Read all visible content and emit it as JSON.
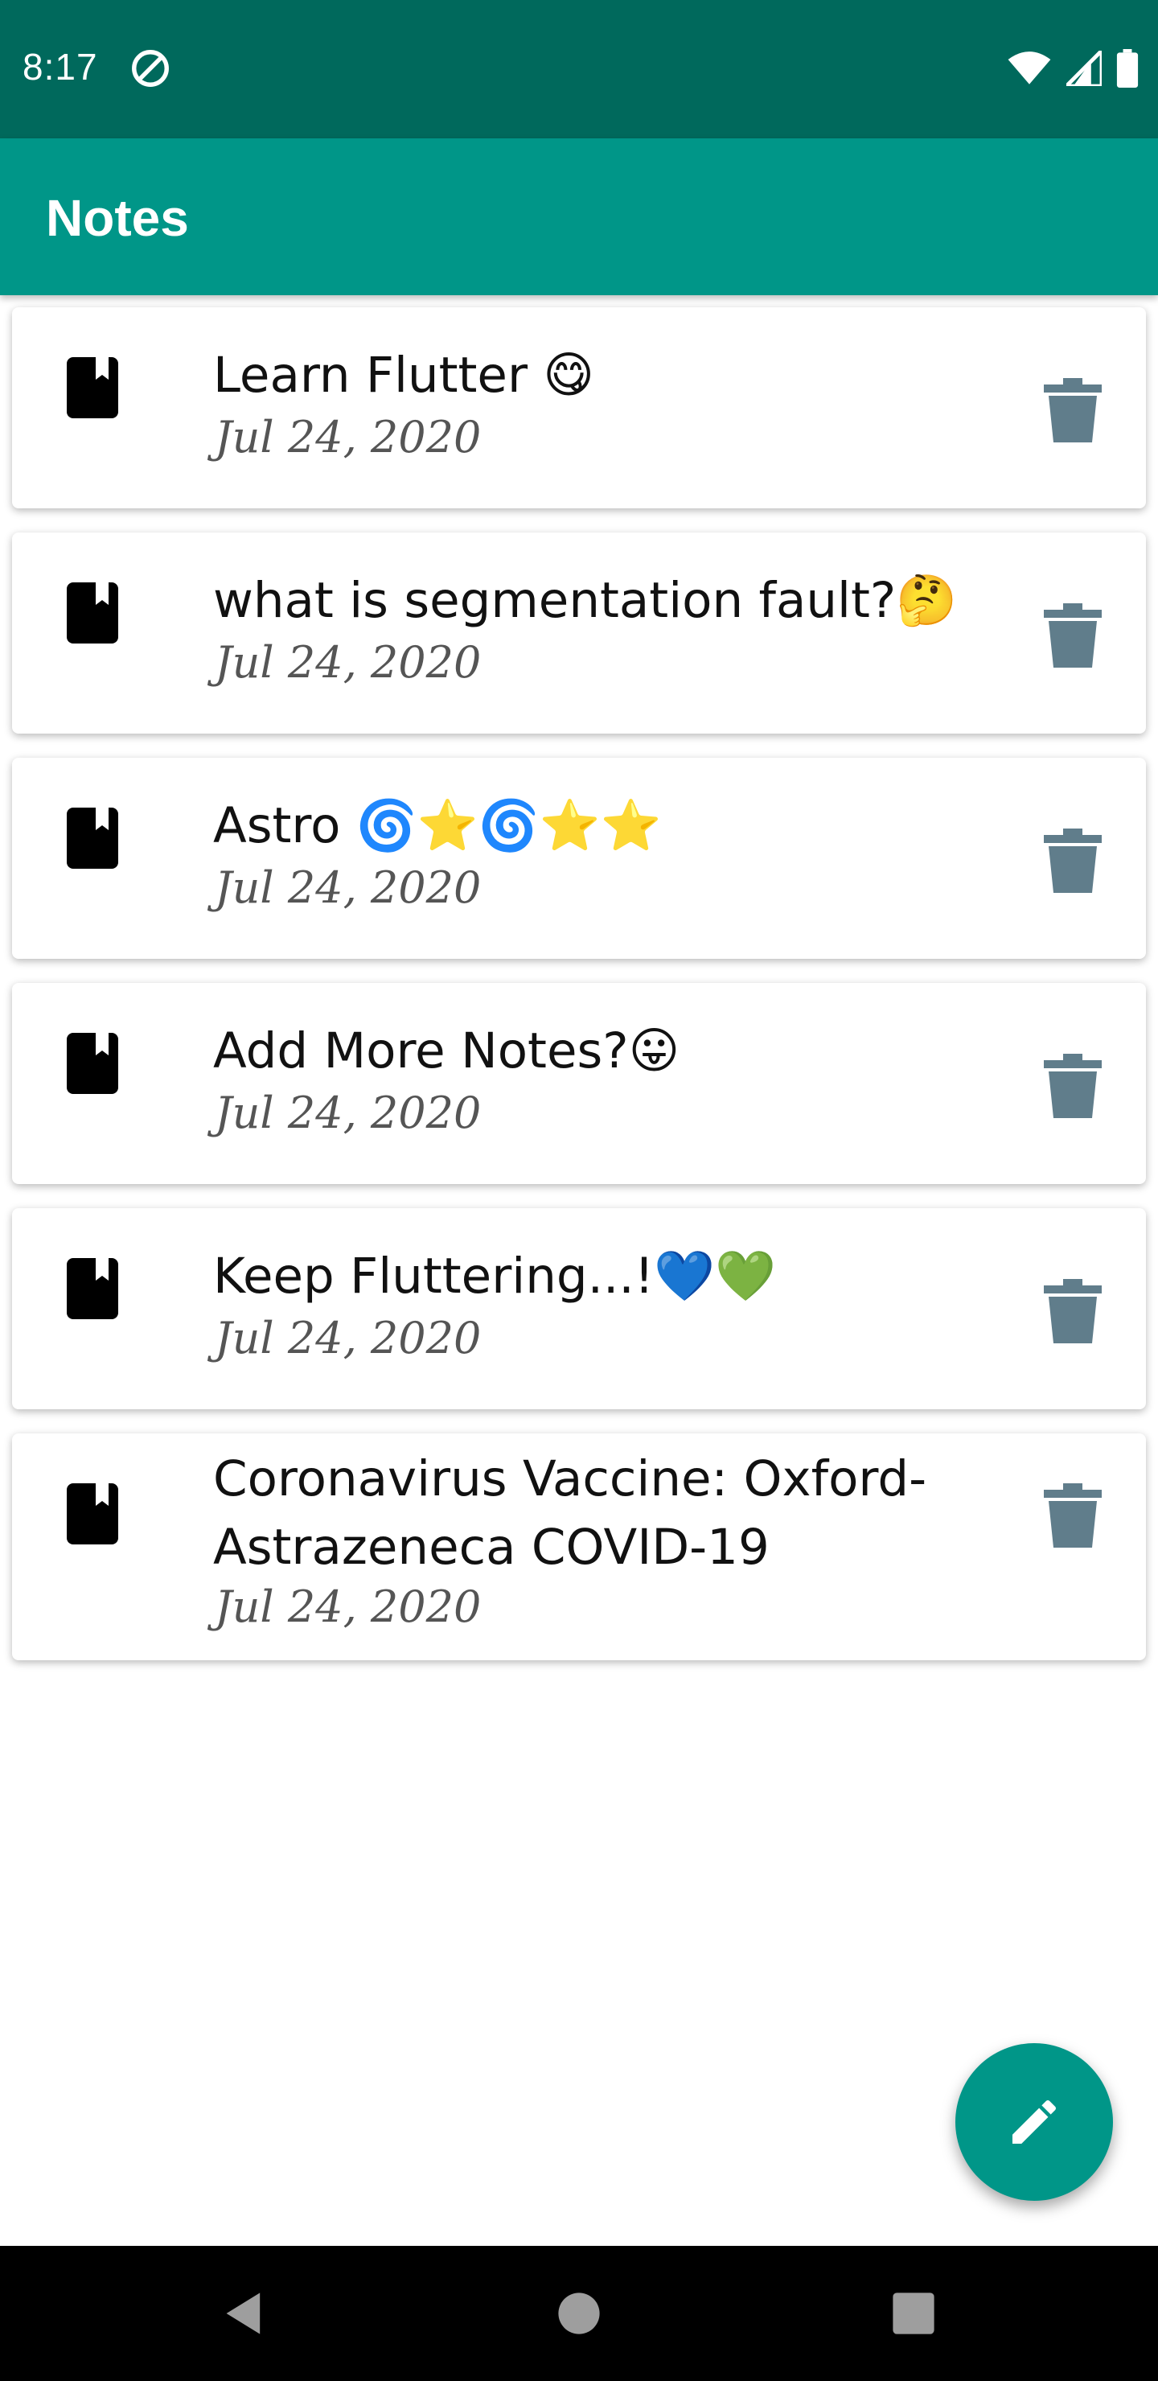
{
  "status": {
    "time": "8:17"
  },
  "appbar": {
    "title": "Notes"
  },
  "colors": {
    "primary": "#009688",
    "status": "#00695c",
    "delete_icon": "#607d8b"
  },
  "notes": [
    {
      "title": "Learn Flutter 😋",
      "date": "Jul 24, 2020"
    },
    {
      "title": "what is segmentation fault?🤔",
      "date": "Jul 24, 2020"
    },
    {
      "title": "Astro 🌀⭐🌀⭐⭐",
      "date": "Jul 24, 2020"
    },
    {
      "title": "Add More Notes?😛",
      "date": "Jul 24, 2020"
    },
    {
      "title": "Keep Fluttering...!💙💚",
      "date": "Jul 24, 2020"
    },
    {
      "title": "Coronavirus Vaccine: Oxford-Astrazeneca COVID-19",
      "date": "Jul 24, 2020"
    }
  ],
  "icons": {
    "note": "book-icon",
    "delete": "trash-icon",
    "fab": "edit-pencil-icon",
    "nav": [
      "back-triangle-icon",
      "home-circle-icon",
      "recents-square-icon"
    ]
  }
}
